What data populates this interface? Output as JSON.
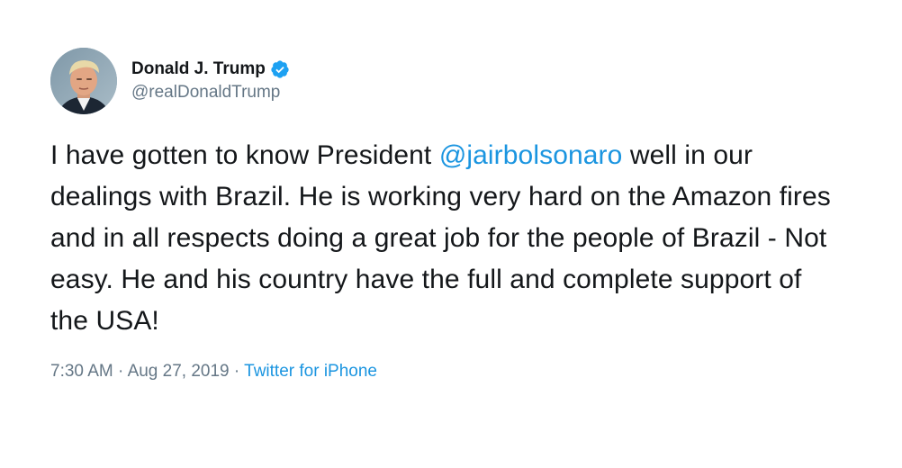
{
  "author": {
    "display_name": "Donald J. Trump",
    "handle": "@realDonaldTrump",
    "verified": true
  },
  "tweet": {
    "text_before": "I have gotten to know President ",
    "mention": "@jairbolsonaro",
    "text_after": " well in our dealings with Brazil. He is working very hard on the Amazon fires and in all respects doing a great job for the people of Brazil - Not easy. He and his country have the full and complete support of the USA!"
  },
  "meta": {
    "time": "7:30 AM",
    "date": "Aug 27, 2019",
    "separator": "·",
    "source": "Twitter for iPhone"
  },
  "colors": {
    "link": "#1b95e0",
    "secondary_text": "#657786",
    "primary_text": "#14171a",
    "verified_badge": "#1da1f2"
  }
}
